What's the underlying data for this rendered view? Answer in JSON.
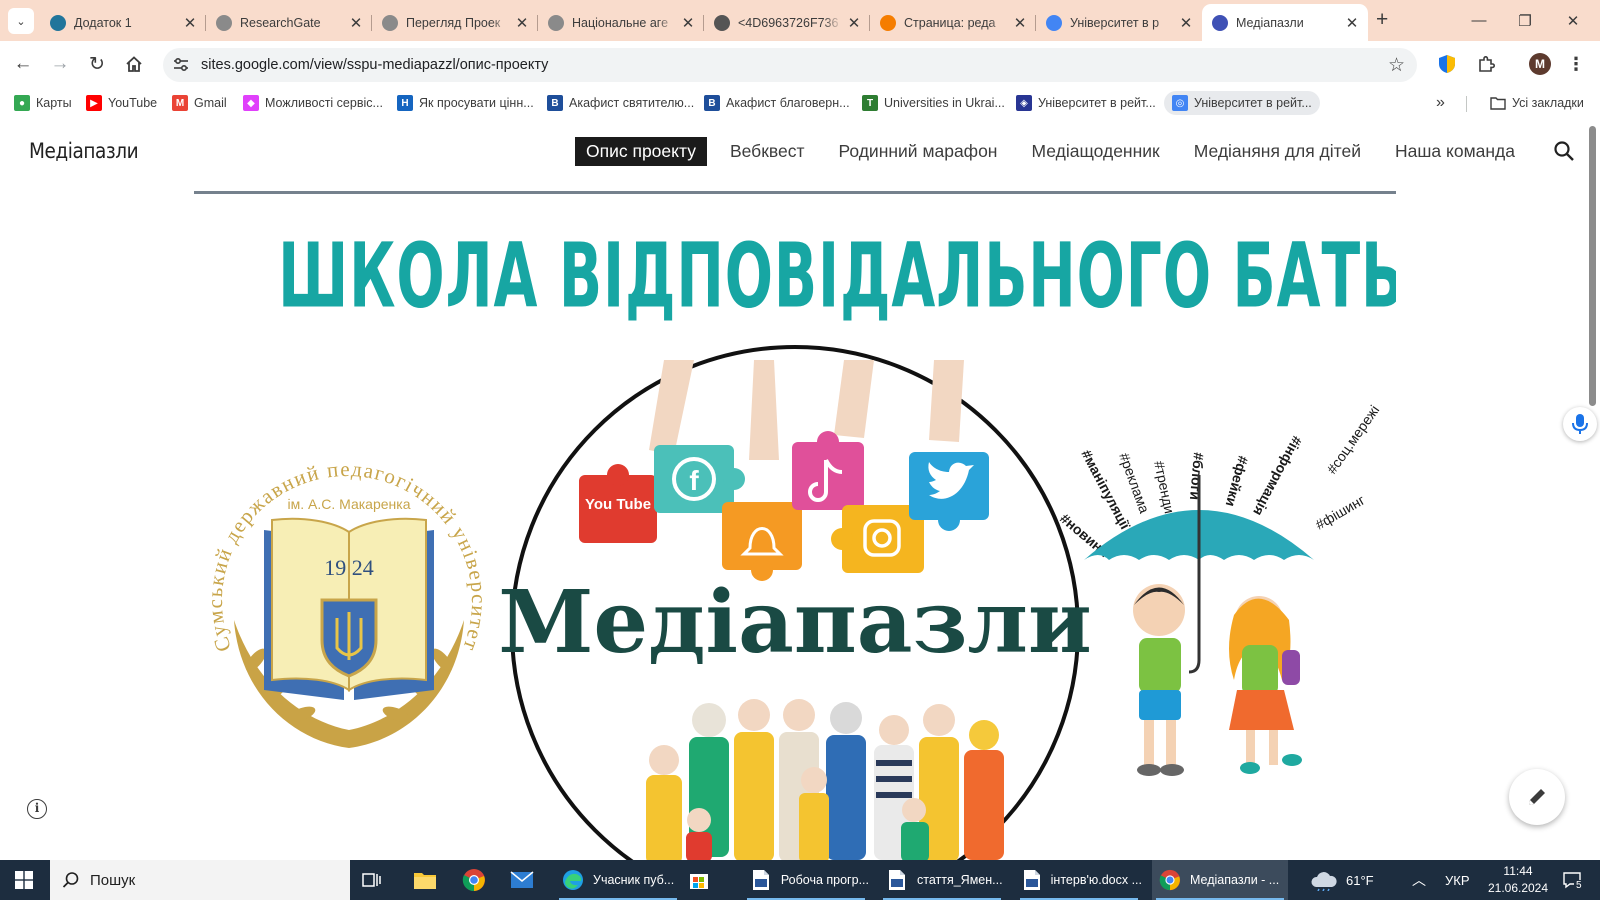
{
  "browser": {
    "tabs": [
      {
        "title": "Додаток 1",
        "icon": "wordpress-icon",
        "color": "#21759b",
        "active": false
      },
      {
        "title": "ResearchGate",
        "icon": "researchgate-icon",
        "color": "#8a8a8a",
        "active": false
      },
      {
        "title": "Перегляд Проек",
        "icon": "site-icon",
        "color": "#8a8a8a",
        "active": false
      },
      {
        "title": "Національне аге",
        "icon": "loading-icon",
        "color": "#8a8a8a",
        "active": false
      },
      {
        "title": "<4D6963726F736",
        "icon": "globe-icon",
        "color": "#555555",
        "active": false
      },
      {
        "title": "Страница: реда",
        "icon": "blogger-icon",
        "color": "#f57d00",
        "active": false
      },
      {
        "title": "Університет в р",
        "icon": "google-sites-icon",
        "color": "#4285f4",
        "active": false
      },
      {
        "title": "Медіапазли",
        "icon": "google-sites-icon",
        "color": "#3f51b5",
        "active": true
      }
    ],
    "new_tab_label": "+",
    "url": "sites.google.com/view/sspu-mediapazzl/опис-проекту",
    "profile_initial": "M",
    "bookmarks": [
      {
        "label": "Карты",
        "icon": "maps-pin-icon"
      },
      {
        "label": "YouTube",
        "icon": "youtube-icon"
      },
      {
        "label": "Gmail",
        "icon": "gmail-icon"
      },
      {
        "label": "Можливості сервіс...",
        "icon": "gallery-icon"
      },
      {
        "label": "Як просувати цінн...",
        "icon": "h-icon"
      },
      {
        "label": "Акафист святителю...",
        "icon": "b-icon"
      },
      {
        "label": "Акафист благоверн...",
        "icon": "b-icon"
      },
      {
        "label": "Universities in Ukrai...",
        "icon": "university-icon"
      },
      {
        "label": "Університет в рейт...",
        "icon": "shield-icon"
      },
      {
        "label": "Університет в рейт...",
        "icon": "google-sites-icon"
      }
    ],
    "more_bookmarks": "»",
    "all_bookmarks": "Усі закладки"
  },
  "site": {
    "title": "Медіапазли",
    "nav": [
      {
        "label": "Опис проекту",
        "active": true
      },
      {
        "label": "Вебквест",
        "active": false
      },
      {
        "label": "Родинний марафон",
        "active": false
      },
      {
        "label": "Медіащоденник",
        "active": false
      },
      {
        "label": "Медіаняня для дітей",
        "active": false
      },
      {
        "label": "Наша команда",
        "active": false
      }
    ],
    "banner": {
      "headline": "ШКОЛА ВІДПОВІДАЛЬНОГО БАТЬКІВСТВА",
      "circle_title": "Медіапазли",
      "logo_arc_text": "Сумський державний педагогічний університет",
      "logo_sub": "ім. А.С. Макаренка",
      "logo_year": "19 24",
      "hashtags": [
        "#новини",
        "#маніпуляції",
        "#реклама",
        "#тренди",
        "#блоги",
        "#фейки",
        "#інформація",
        "#соц.мережі",
        "#фішинг"
      ],
      "puzzle_youtube": "You Tube",
      "colors": {
        "teal": "#17a6a3",
        "gold": "#c8a54a",
        "title_dark": "#1a4a44"
      }
    }
  },
  "taskbar": {
    "search_placeholder": "Пошук",
    "apps": [
      {
        "label": "Учасник пуб...",
        "icon": "edge-icon"
      },
      {
        "label": "Робоча прогр...",
        "icon": "word-doc-icon"
      },
      {
        "label": "стаття_Ямен...",
        "icon": "word-doc-icon"
      },
      {
        "label": "інтерв'ю.docx ...",
        "icon": "word-doc-icon"
      },
      {
        "label": "Медіапазли - ...",
        "icon": "chrome-icon"
      }
    ],
    "weather": "61°F",
    "language": "УКР",
    "time": "11:44",
    "date": "21.06.2024",
    "notifications": "5"
  }
}
